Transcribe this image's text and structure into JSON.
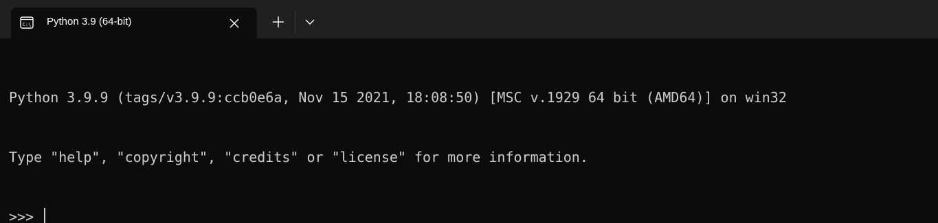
{
  "tab": {
    "title": "Python 3.9 (64-bit)",
    "icon": "terminal-prompt-icon"
  },
  "toolbar": {
    "close_icon": "close-icon",
    "new_tab_icon": "plus-icon",
    "dropdown_icon": "chevron-down-icon"
  },
  "terminal": {
    "lines": [
      "Python 3.9.9 (tags/v3.9.9:ccb0e6a, Nov 15 2021, 18:08:50) [MSC v.1929 64 bit (AMD64)] on win32",
      "Type \"help\", \"copyright\", \"credits\" or \"license\" for more information."
    ],
    "prompt": ">>> "
  },
  "colors": {
    "tabbar_bg": "#202020",
    "terminal_bg": "#0c0c0c",
    "terminal_fg": "#cccccc"
  }
}
